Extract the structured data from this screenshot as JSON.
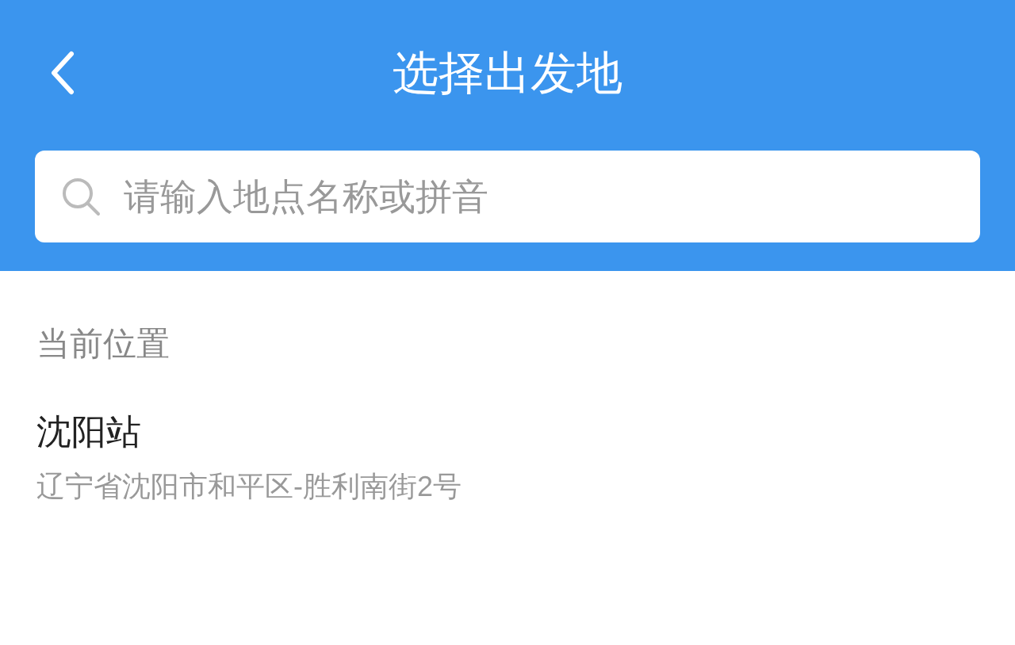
{
  "header": {
    "title": "选择出发地"
  },
  "search": {
    "placeholder": "请输入地点名称或拼音"
  },
  "section_title": "当前位置",
  "locations": [
    {
      "name": "沈阳站",
      "address": "辽宁省沈阳市和平区-胜利南街2号"
    }
  ]
}
